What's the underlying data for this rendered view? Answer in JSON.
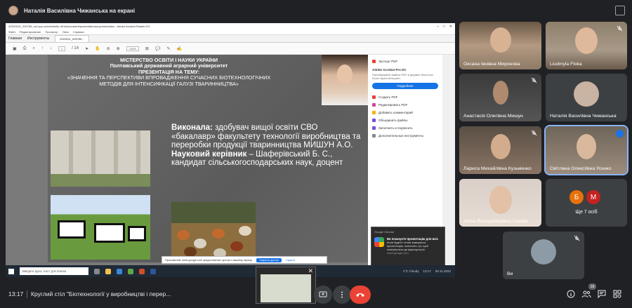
{
  "presenter_banner": "Наталія Василівна Чижанська на екрані",
  "acrobat": {
    "title": "20221021_200755_m4.cpp.co/ml/trientic.off.io/document/presentationsd.presentation - Adobe Acrobat Reader DC",
    "menu": [
      "Файл",
      "Редактирование",
      "Просмотр",
      "Окно",
      "Справка"
    ],
    "tabs": [
      "Главная",
      "Инструменты"
    ],
    "doc_tab": "2022021_005755...",
    "page": "1",
    "page_total": "/ 14",
    "zoom": "134%",
    "right_panel": {
      "export_label": "Экспорт PDF",
      "promo_title": "Adobe Acrobat Pro DC",
      "promo_desc": "Преобразуйте файлы PDF в формат Word или Excel через Интернет.",
      "promo_button": "Подробнее",
      "items": [
        "Создать PDF",
        "Редактировать PDF",
        "Добавить комментарий",
        "Объединить файлы",
        "Заполнить и подписать",
        "Дополнительные инструменты"
      ]
    }
  },
  "slide": {
    "header": [
      "МІСТЕРСТВО ОСВІТИ І НАУКИ УКРАЇНИ",
      "Полтавський державний аграрний університет",
      "ПРЕЗЕНТАЦІЯ НА ТЕМУ:",
      "«ЗНАЧЕННЯ ТА ПЕРСПЕКТИВИ ВПРОВАДЖЕННЯ СУЧАСНИХ БІОТЕХНОЛОГІЧНИХ",
      "МЕТОДІВ ДЛЯ ІНТЕНСИФІКАЦІЇ ГАЛУЗІ ТВАРИННИЦТВА»"
    ],
    "author_label": "Виконала:",
    "author_text": " здобувач вищої освіти СВО «бакалавр» факультету технології виробництва та переробки продукції тваринництва МИШУН А.О.",
    "supervisor_label": "Науковий керівник",
    "supervisor_text": " – Шаферівський Б. С., кандидат сільськогосподарських наук, доцент"
  },
  "sharing_bar": {
    "text": "Прохожений: meet.google.com предоставляет доступ к вашему экрану.",
    "stop": "Закрыть доступ",
    "hide": "Скрыть"
  },
  "chrome_notification": {
    "app": "Google Chrome",
    "title": "Ви показуєте презентацію для всіх",
    "body": "Коли будете готові завершити презентацію, натисніть тут, щоб повернутися до відеозустрічі.",
    "source": "meet.google.com"
  },
  "taskbar": {
    "search_placeholder": "Введите здесь текст для поиска",
    "weather": "1°C Cloudy",
    "time": "13:17",
    "date": "30.11.2022"
  },
  "participants": [
    {
      "name": "Оксана Івнівна Миронова"
    },
    {
      "name": "Liudmyla Floka"
    },
    {
      "name": "Анастасія Олегівна Мишун"
    },
    {
      "name": "Наталія Василівна Чижанська"
    },
    {
      "name": "Лариса Михайлівна Кузьменко"
    },
    {
      "name": "Світлана Олексіївна Усенко"
    },
    {
      "name": "Аліна Володимирівна Саюків"
    },
    {
      "name": "Ще 7 осіб",
      "badges": [
        "Б",
        "М"
      ]
    },
    {
      "name": "Ви"
    }
  ],
  "bottom_bar": {
    "time": "13:17",
    "meeting_title": "Круглий стіл \"Біотехнології у виробництві і перер...",
    "participant_count": "16"
  },
  "colors": {
    "background": "#202124",
    "tile": "#3c4043",
    "end_call": "#ea4335",
    "accent": "#1a73e8",
    "badge_b": "#e8710a",
    "badge_m": "#c5221f"
  }
}
